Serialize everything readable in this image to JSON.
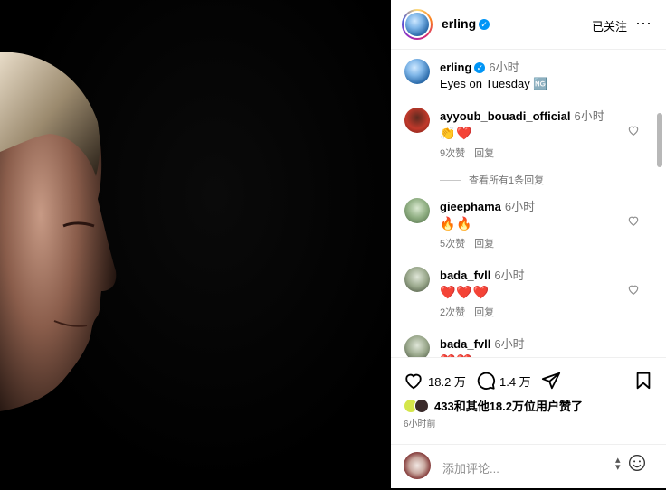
{
  "post": {
    "author": "erling",
    "follow_state": "已关注",
    "more_icon": "more-icon",
    "caption_time": "6小时",
    "caption": "Eyes on Tuesday 🆖"
  },
  "comments": [
    {
      "user": "ayyoub_bouadi_official",
      "time": "6小时",
      "text": "👏❤️",
      "likes": "9次赞",
      "reply": "回复",
      "view_replies": "查看所有1条回复"
    },
    {
      "user": "gieephama",
      "time": "6小时",
      "text": "🔥🔥",
      "likes": "5次赞",
      "reply": "回复"
    },
    {
      "user": "bada_fvll",
      "time": "6小时",
      "text": "❤️❤️❤️",
      "likes": "2次赞",
      "reply": "回复"
    },
    {
      "user": "bada_fvll",
      "time": "6小时",
      "text": "❤️❤️"
    }
  ],
  "actions": {
    "like_count": "18.2 万",
    "comment_count": "1.4 万"
  },
  "liked_by": "433和其他18.2万位用户赞了",
  "posted": "6小时前",
  "comment_input": {
    "placeholder": "添加评论..."
  }
}
